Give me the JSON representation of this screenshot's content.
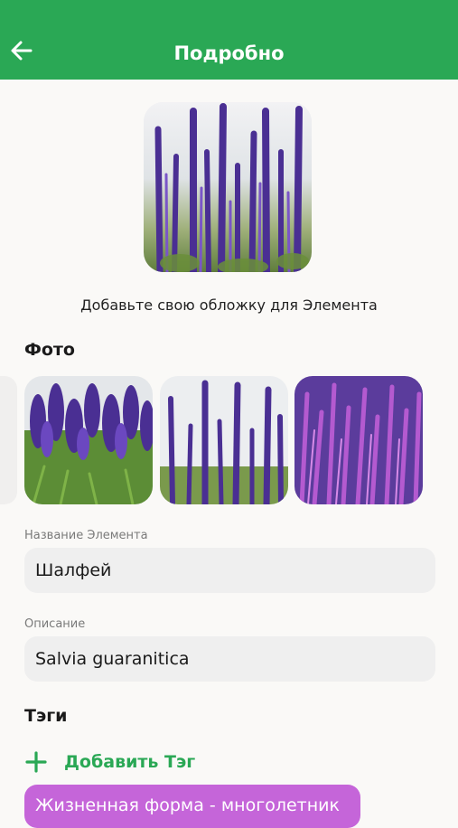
{
  "header": {
    "title": "Подробно",
    "back_icon": "arrow-left-icon",
    "background": "#2aa855"
  },
  "cover": {
    "caption": "Добавьте свою обложку для Элемента"
  },
  "photos": {
    "title": "Фото",
    "count": 3
  },
  "fields": {
    "name": {
      "label": "Название Элемента",
      "value": "Шалфей"
    },
    "description": {
      "label": "Описание",
      "value": "Salvia guaranitica"
    }
  },
  "tags": {
    "title": "Тэги",
    "add_label": "Добавить Тэг",
    "add_icon": "plus-icon",
    "items": [
      {
        "label": "Жизненная форма - многолетник",
        "color": "#c565d9"
      }
    ]
  },
  "colors": {
    "accent": "#2aa855",
    "tag": "#c565d9",
    "field_bg": "#efefef"
  }
}
